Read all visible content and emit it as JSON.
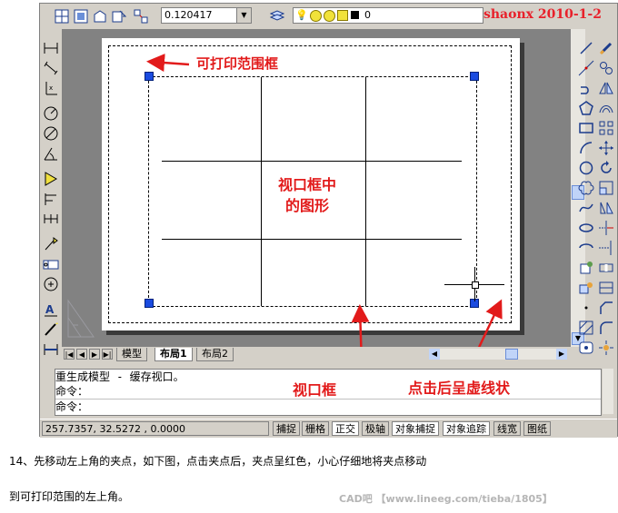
{
  "toolbar": {
    "linetype_scale": "0.120417",
    "layer_value": "0",
    "watermark": "shaonx 2010-1-2"
  },
  "annotations": {
    "printable_range": "可打印范围框",
    "viewport_graphics_line1": "视口框中",
    "viewport_graphics_line2": "的图形",
    "viewport_frame": "视口框",
    "dashed_after_click": "点击后呈虚线状"
  },
  "layout_tabs": [
    "模型",
    "布局1",
    "布局2"
  ],
  "command": {
    "line1": "重生成模型 - 缓存视口。",
    "line2": "命令：",
    "line3": "命令："
  },
  "status": {
    "coordinates": "257.7357, 32.5272 , 0.0000",
    "buttons": [
      "捕捉",
      "栅格",
      "正交",
      "极轴",
      "对象捕捉",
      "对象追踪",
      "线宽",
      "图纸"
    ]
  },
  "caption": {
    "line1": "14、先移动左上角的夹点，如下图，点击夹点后，夹点呈红色，小心仔细地将夹点移动",
    "line2": "到可打印范围的左上角。"
  },
  "footer": "CAD吧 【www.lineeg.com/tieba/1805】",
  "colors": {
    "annotation_red": "#e21b1b",
    "grip_blue": "#1a4be0",
    "canvas_gray": "#828282"
  }
}
